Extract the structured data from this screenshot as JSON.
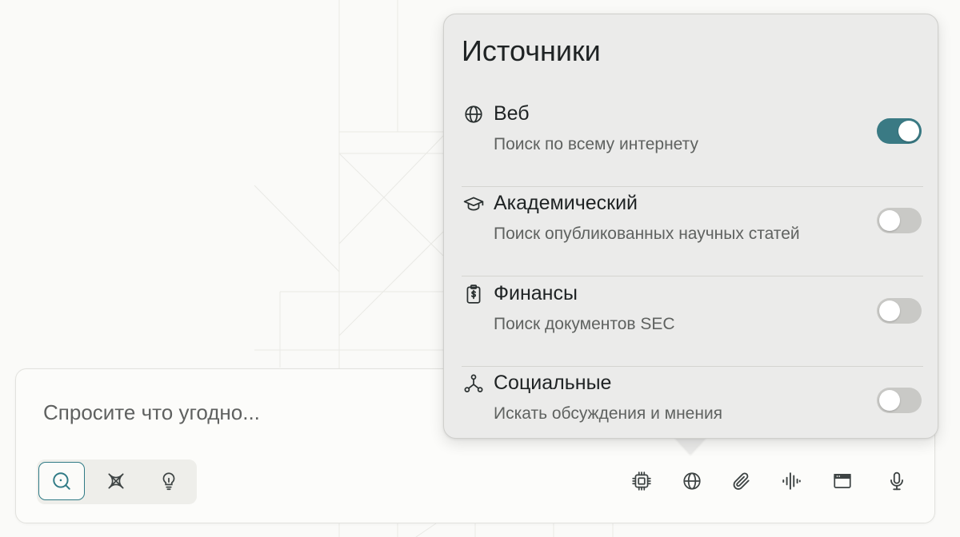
{
  "search": {
    "placeholder": "Спросите что угодно..."
  },
  "modes": [
    {
      "icon": "search-icon",
      "active": true
    },
    {
      "icon": "atom-icon",
      "active": false
    },
    {
      "icon": "lightbulb-icon",
      "active": false
    }
  ],
  "tools": [
    {
      "icon": "cpu-chip-icon"
    },
    {
      "icon": "globe-icon"
    },
    {
      "icon": "paperclip-icon"
    },
    {
      "icon": "audio-waveform-icon"
    },
    {
      "icon": "browser-window-icon"
    },
    {
      "icon": "microphone-icon"
    }
  ],
  "sources_popover": {
    "title": "Источники",
    "items": [
      {
        "icon": "globe-icon",
        "name": "Веб",
        "description": "Поиск по всему интернету",
        "enabled": true
      },
      {
        "icon": "graduation-cap-icon",
        "name": "Академический",
        "description": "Поиск опубликованных научных статей",
        "enabled": false
      },
      {
        "icon": "finance-clipboard-icon",
        "name": "Финансы",
        "description": "Поиск документов SEC",
        "enabled": false
      },
      {
        "icon": "social-network-icon",
        "name": "Социальные",
        "description": "Искать обсуждения и мнения",
        "enabled": false
      }
    ]
  },
  "colors": {
    "accent": "#3a7a84",
    "toggle_off": "#c9c9c6",
    "popover_bg": "#ebebea",
    "page_bg": "#fafaf8"
  }
}
